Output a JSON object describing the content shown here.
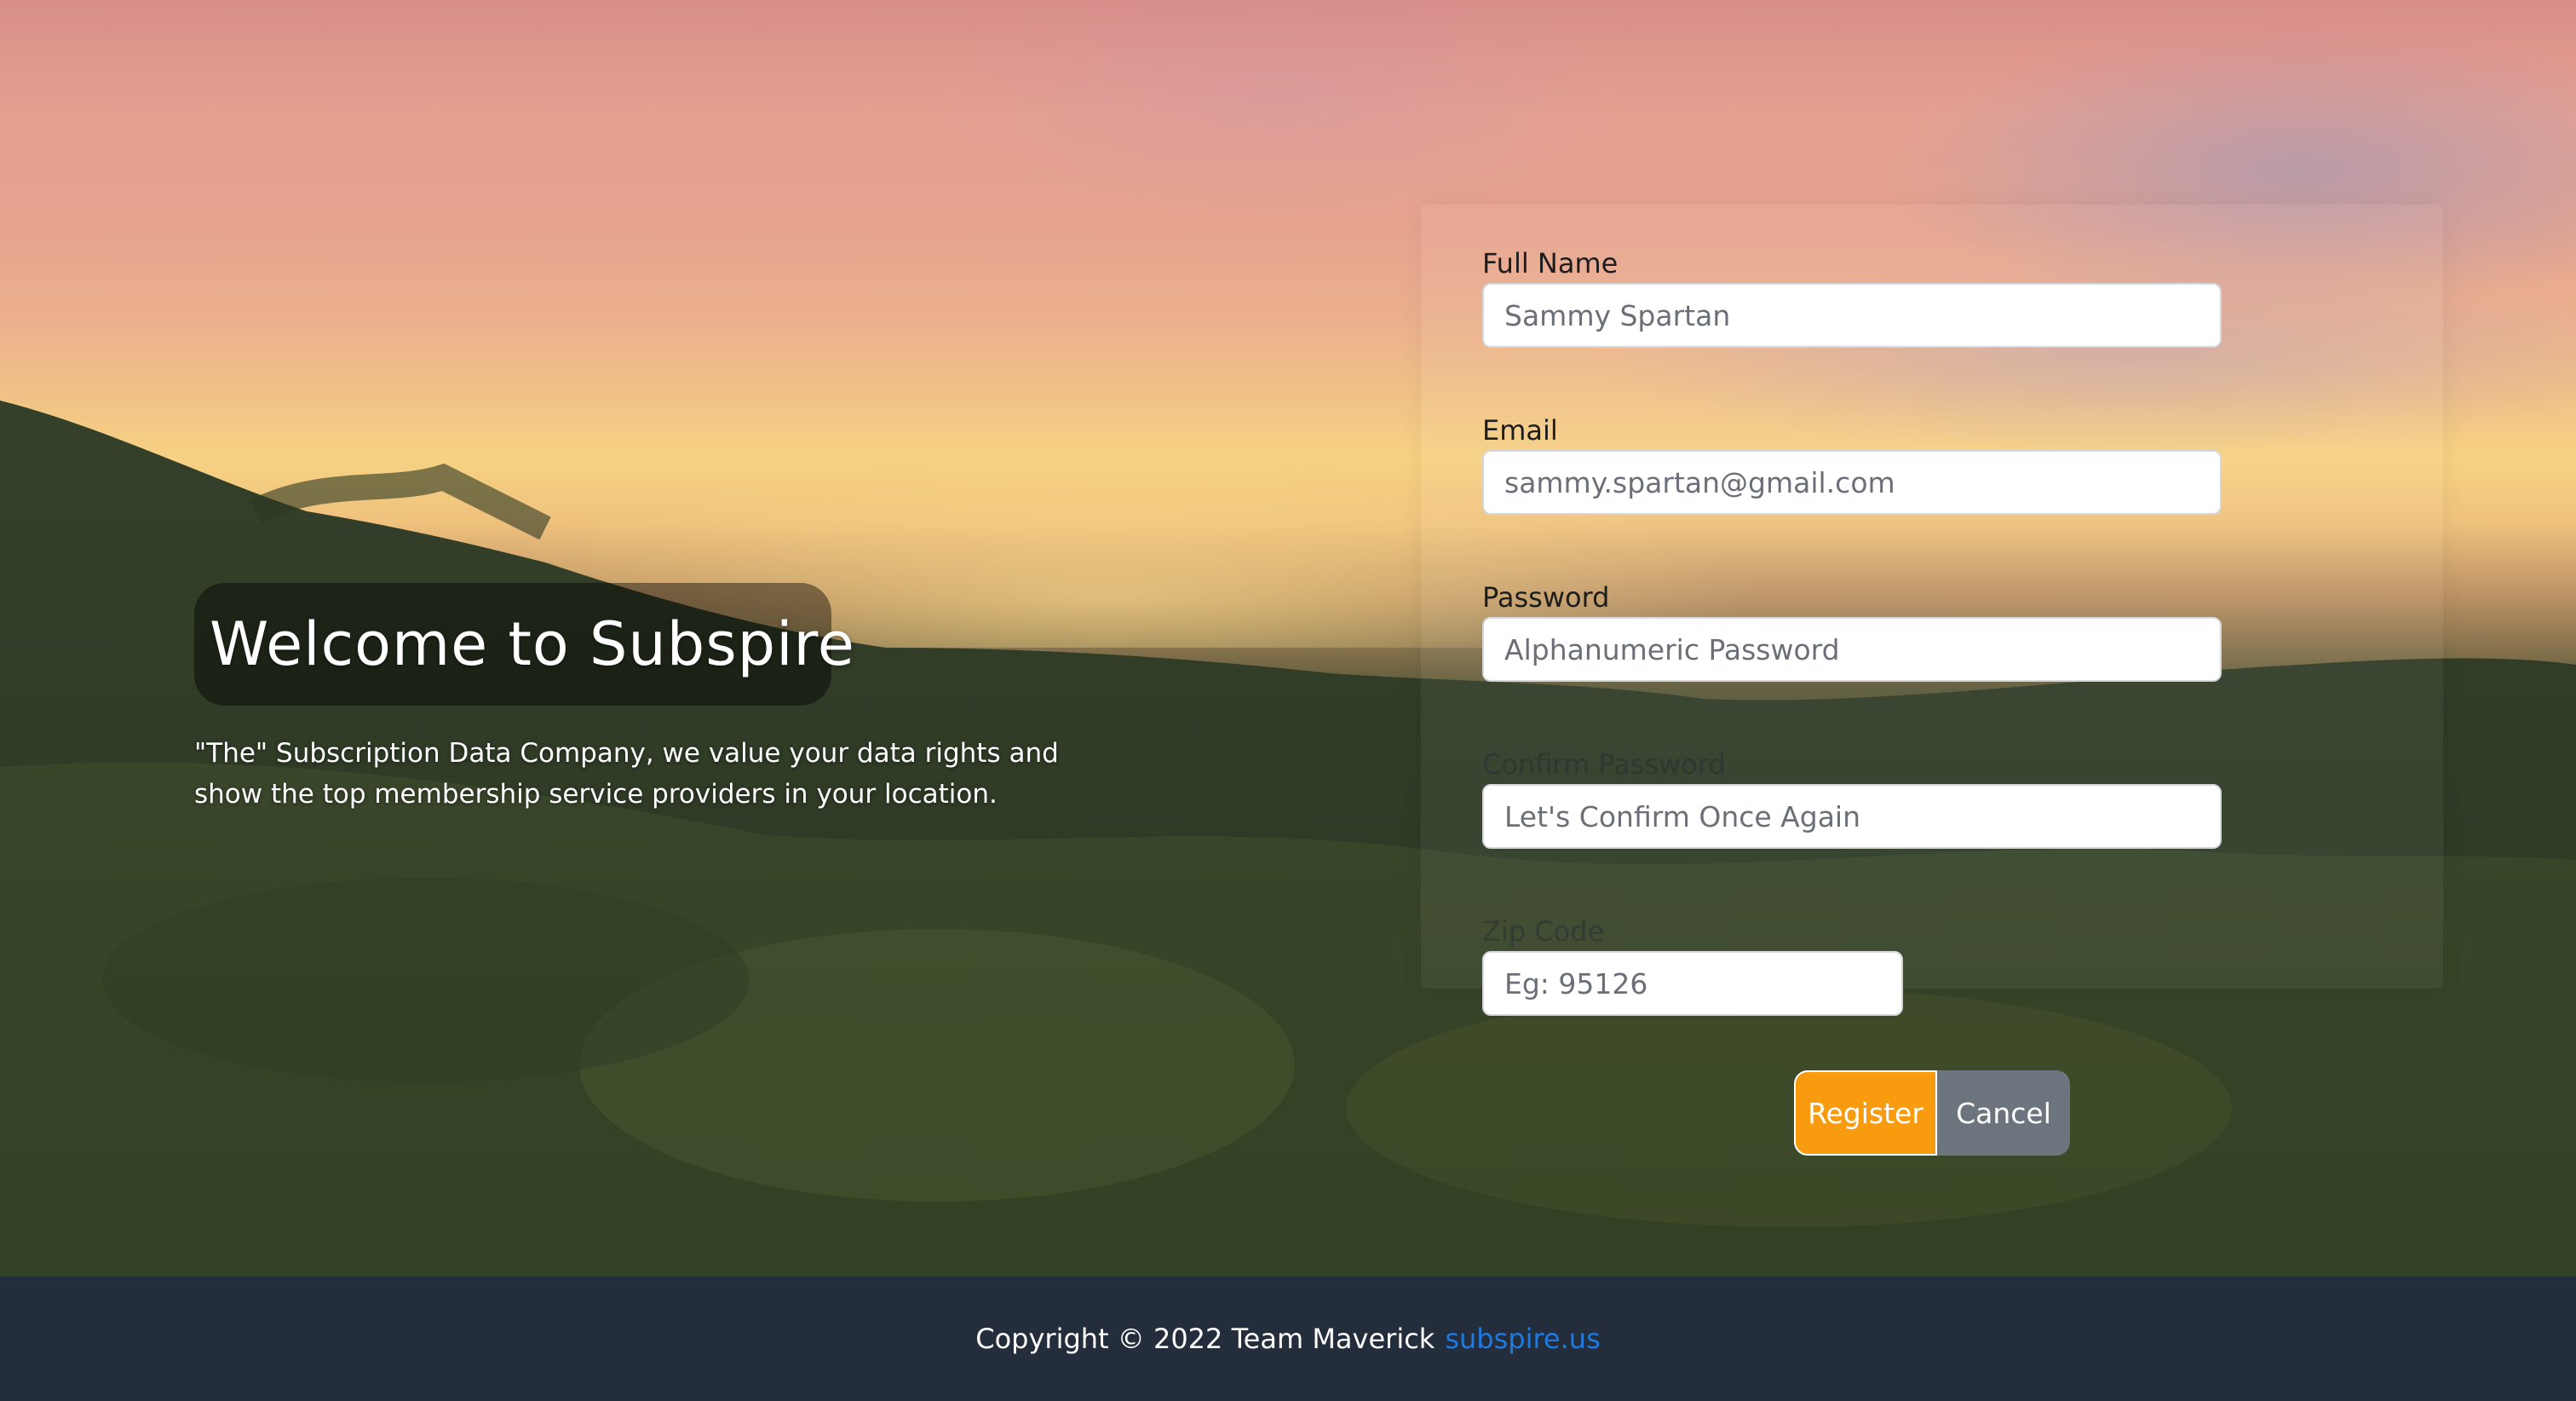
{
  "intro": {
    "title": "Welcome to Subspire",
    "tagline": "\"The\" Subscription Data Company, we value your data rights and show the top membership service providers in your location."
  },
  "form": {
    "full_name": {
      "label": "Full Name",
      "placeholder": "Sammy Spartan"
    },
    "email": {
      "label": "Email",
      "placeholder": "sammy.spartan@gmail.com"
    },
    "password": {
      "label": "Password",
      "placeholder": "Alphanumeric Password"
    },
    "confirm_password": {
      "label": "Confirm Password",
      "placeholder": "Let's Confirm Once Again"
    },
    "zip_code": {
      "label": "Zip Code",
      "placeholder": "Eg: 95126"
    },
    "register_label": "Register",
    "cancel_label": "Cancel"
  },
  "footer": {
    "copyright": "Copyright © 2022 Team Maverick",
    "link_text": "subspire.us"
  },
  "colors": {
    "register_button": "#f89b0f",
    "cancel_button": "#6c757d",
    "footer_background": "#232d3c",
    "footer_link": "#1f7ae0"
  }
}
